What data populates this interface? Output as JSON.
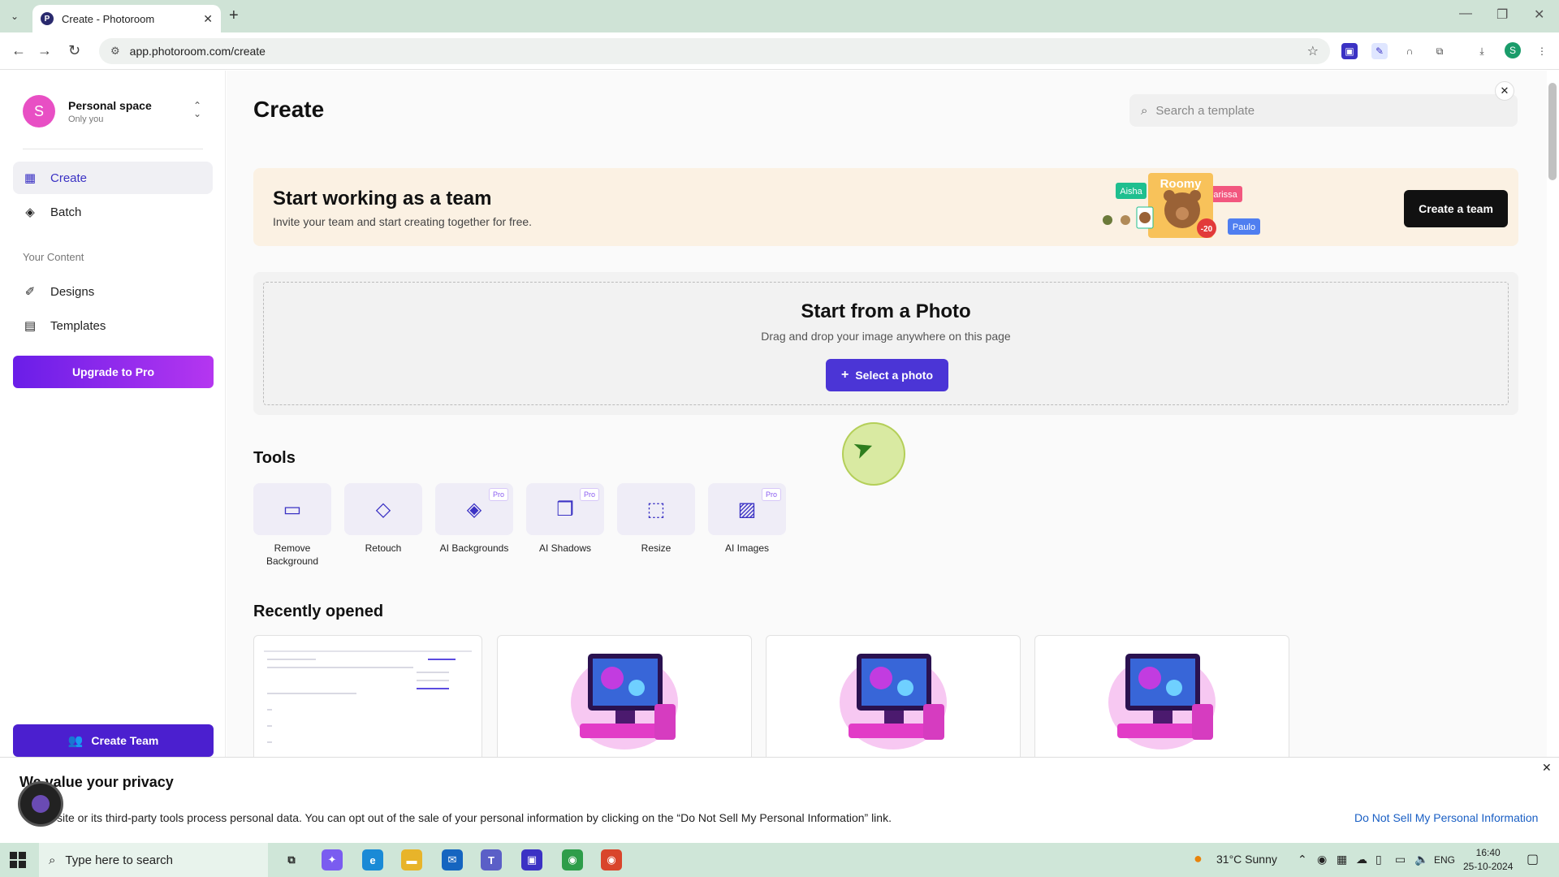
{
  "browser": {
    "tab_title": "Create - Photoroom",
    "favicon": "P",
    "url": "app.photoroom.com/create",
    "profile_initial": "S"
  },
  "sidebar": {
    "workspace_initial": "S",
    "workspace_name": "Personal space",
    "workspace_sub": "Only you",
    "items": [
      {
        "label": "Create",
        "icon": "grid-icon"
      },
      {
        "label": "Batch",
        "icon": "layers-icon"
      }
    ],
    "section_label": "Your Content",
    "content_items": [
      {
        "label": "Designs",
        "icon": "brush-icon"
      },
      {
        "label": "Templates",
        "icon": "template-icon"
      }
    ],
    "upgrade_label": "Upgrade to Pro",
    "team_label": "Create Team"
  },
  "main": {
    "title": "Create",
    "search_placeholder": "Search a template",
    "banner": {
      "title": "Start working as a team",
      "subtitle": "Invite your team and start creating together for free.",
      "button": "Create a team",
      "tags": [
        "Aisha",
        "Larissa",
        "Paulo"
      ],
      "art_title": "Roomy",
      "badge": "-20"
    },
    "dropzone": {
      "title": "Start from a Photo",
      "subtitle": "Drag and drop your image anywhere on this page",
      "button": "Select a photo"
    },
    "tools_title": "Tools",
    "tools": [
      {
        "label": "Remove Background",
        "icon": "remove-bg-icon",
        "pro": ""
      },
      {
        "label": "Retouch",
        "icon": "eraser-icon",
        "pro": ""
      },
      {
        "label": "AI Backgrounds",
        "icon": "layers-icon",
        "pro": "Pro"
      },
      {
        "label": "AI Shadows",
        "icon": "shadow-icon",
        "pro": "Pro"
      },
      {
        "label": "Resize",
        "icon": "resize-icon",
        "pro": ""
      },
      {
        "label": "AI Images",
        "icon": "image-sparkle-icon",
        "pro": "Pro"
      }
    ],
    "recent_title": "Recently opened"
  },
  "privacy": {
    "title": "We value your privacy",
    "text": "site or its third-party tools process personal data. You can opt out of the sale of your personal information by clicking on the “Do Not Sell My Personal Information” link.",
    "link": "Do Not Sell My Personal Information"
  },
  "taskbar": {
    "search_placeholder": "Type here to search",
    "weather": "31°C  Sunny",
    "lang": "ENG",
    "time": "16:40",
    "date": "25-10-2024"
  },
  "colors": {
    "accent": "#4b35d6",
    "upgrade_start": "#6a1ee8",
    "upgrade_end": "#b536f0",
    "banner_bg": "#fbf1e3"
  }
}
